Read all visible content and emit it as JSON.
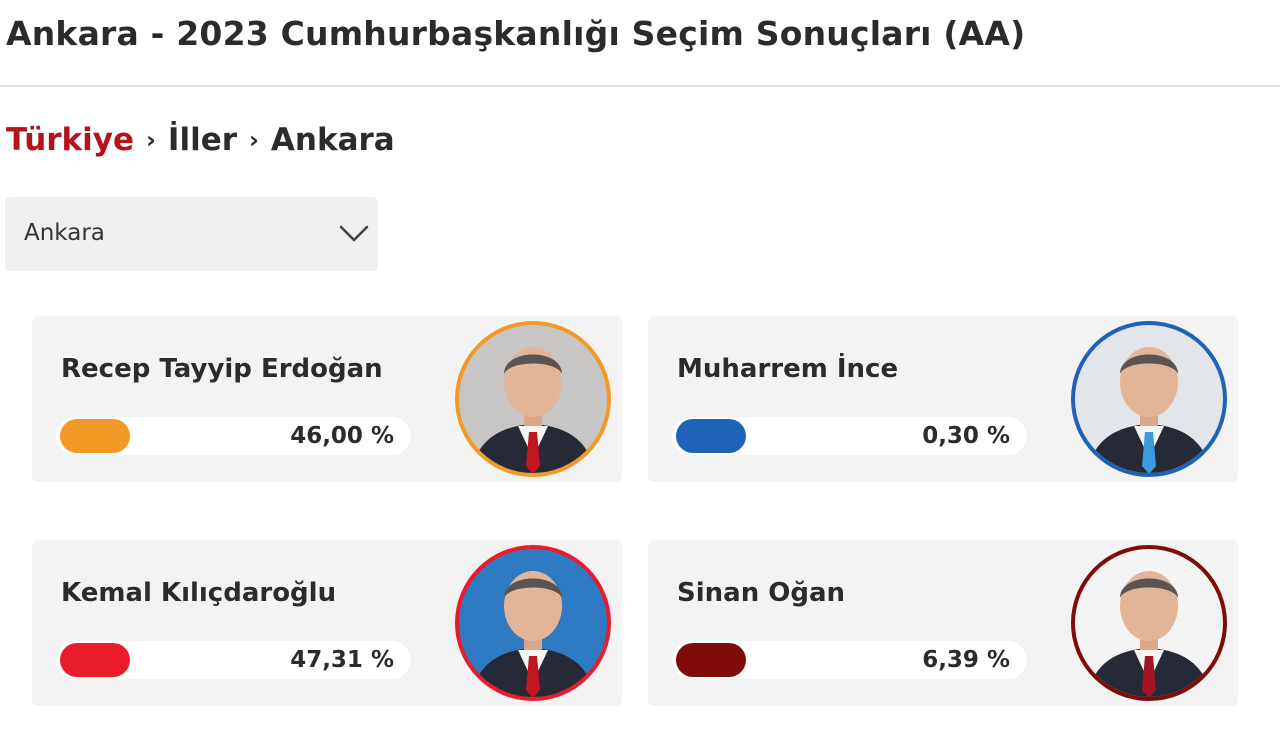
{
  "page": {
    "title": "Ankara - 2023 Cumhurbaşkanlığı Seçim Sonuçları (AA)"
  },
  "breadcrumb": {
    "items": [
      "Türkiye",
      "İller",
      "Ankara"
    ],
    "separator": "›"
  },
  "province_select": {
    "value": "Ankara",
    "icon": "chevron-down-icon"
  },
  "candidates": [
    {
      "name": "Recep Tayyip Erdoğan",
      "percent": "46,00 %",
      "color": "#f39a26",
      "avatar_bg": "#c8c6c4",
      "tie_color": "#c0161d",
      "icon": "candidate-photo"
    },
    {
      "name": "Muharrem İnce",
      "percent": "0,30 %",
      "color": "#1e63b5",
      "avatar_bg": "#e2e6ea",
      "tie_color": "#3a9be0",
      "icon": "candidate-photo"
    },
    {
      "name": "Kemal Kılıçdaroğlu",
      "percent": "47,31 %",
      "color": "#ea1b2b",
      "avatar_bg": "#2e7bc4",
      "tie_color": "#c0161d",
      "icon": "candidate-photo"
    },
    {
      "name": "Sinan Oğan",
      "percent": "6,39 %",
      "color": "#7f0b0b",
      "avatar_bg": "#f4f4f4",
      "tie_color": "#a31520",
      "icon": "candidate-photo"
    }
  ]
}
